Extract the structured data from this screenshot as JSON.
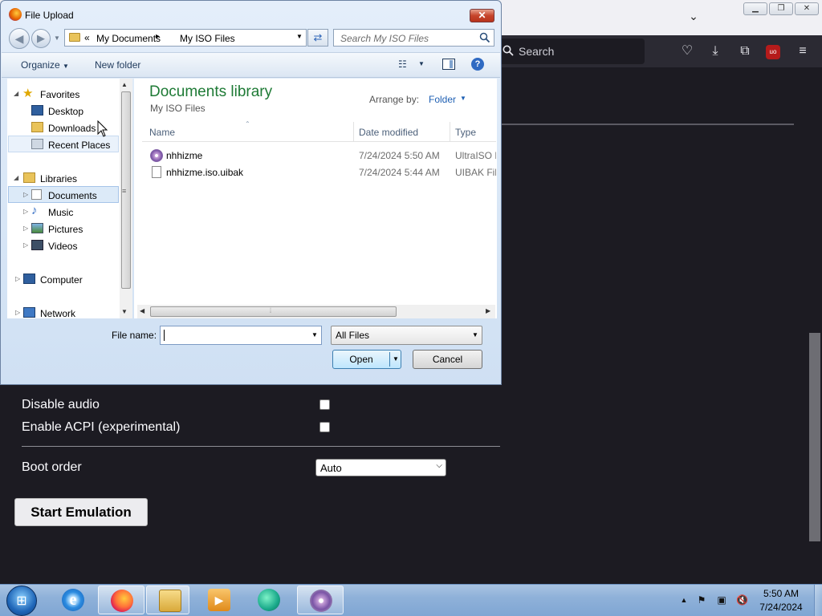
{
  "dialog": {
    "title": "File Upload",
    "close_glyph": "✕",
    "address": {
      "chevron": "«",
      "crumbs": [
        "My Documents",
        "My ISO Files"
      ],
      "separator": "▸"
    },
    "search_placeholder": "Search My ISO Files",
    "toolbar": {
      "organize": "Organize",
      "new_folder": "New folder",
      "help": "?"
    },
    "nav": {
      "favorites": "Favorites",
      "desktop": "Desktop",
      "downloads": "Downloads",
      "recent_places": "Recent Places",
      "libraries": "Libraries",
      "documents": "Documents",
      "music": "Music",
      "pictures": "Pictures",
      "videos": "Videos",
      "computer": "Computer",
      "network": "Network"
    },
    "library": {
      "title": "Documents library",
      "subtitle": "My ISO Files",
      "arrange_label": "Arrange by:",
      "arrange_value": "Folder"
    },
    "columns": {
      "name": "Name",
      "date": "Date modified",
      "type": "Type"
    },
    "files": [
      {
        "name": "nhhizme",
        "date": "7/24/2024 5:50 AM",
        "type": "UltraISO File",
        "icon": "iso-disc-icon"
      },
      {
        "name": "nhhizme.iso.uibak",
        "date": "7/24/2024 5:44 AM",
        "type": "UIBAK File",
        "icon": "blank-file-icon"
      }
    ],
    "file_name_label": "File name:",
    "file_name_value": "",
    "filter": "All Files",
    "open": "Open",
    "cancel": "Cancel"
  },
  "browser": {
    "search_placeholder": "Search",
    "options": [
      {
        "label": "Disable audio",
        "checked": false
      },
      {
        "label": "Enable ACPI (experimental)",
        "checked": false
      }
    ],
    "boot_order_label": "Boot order",
    "boot_order_value": "Auto",
    "start_button": "Start Emulation",
    "ublock_badge": "uo"
  },
  "taskbar": {
    "time": "5:50 AM",
    "date": "7/24/2024"
  },
  "colors": {
    "page_bg": "#1c1b22",
    "library_title": "#1e7a35",
    "link_blue": "#1e5fb3"
  }
}
